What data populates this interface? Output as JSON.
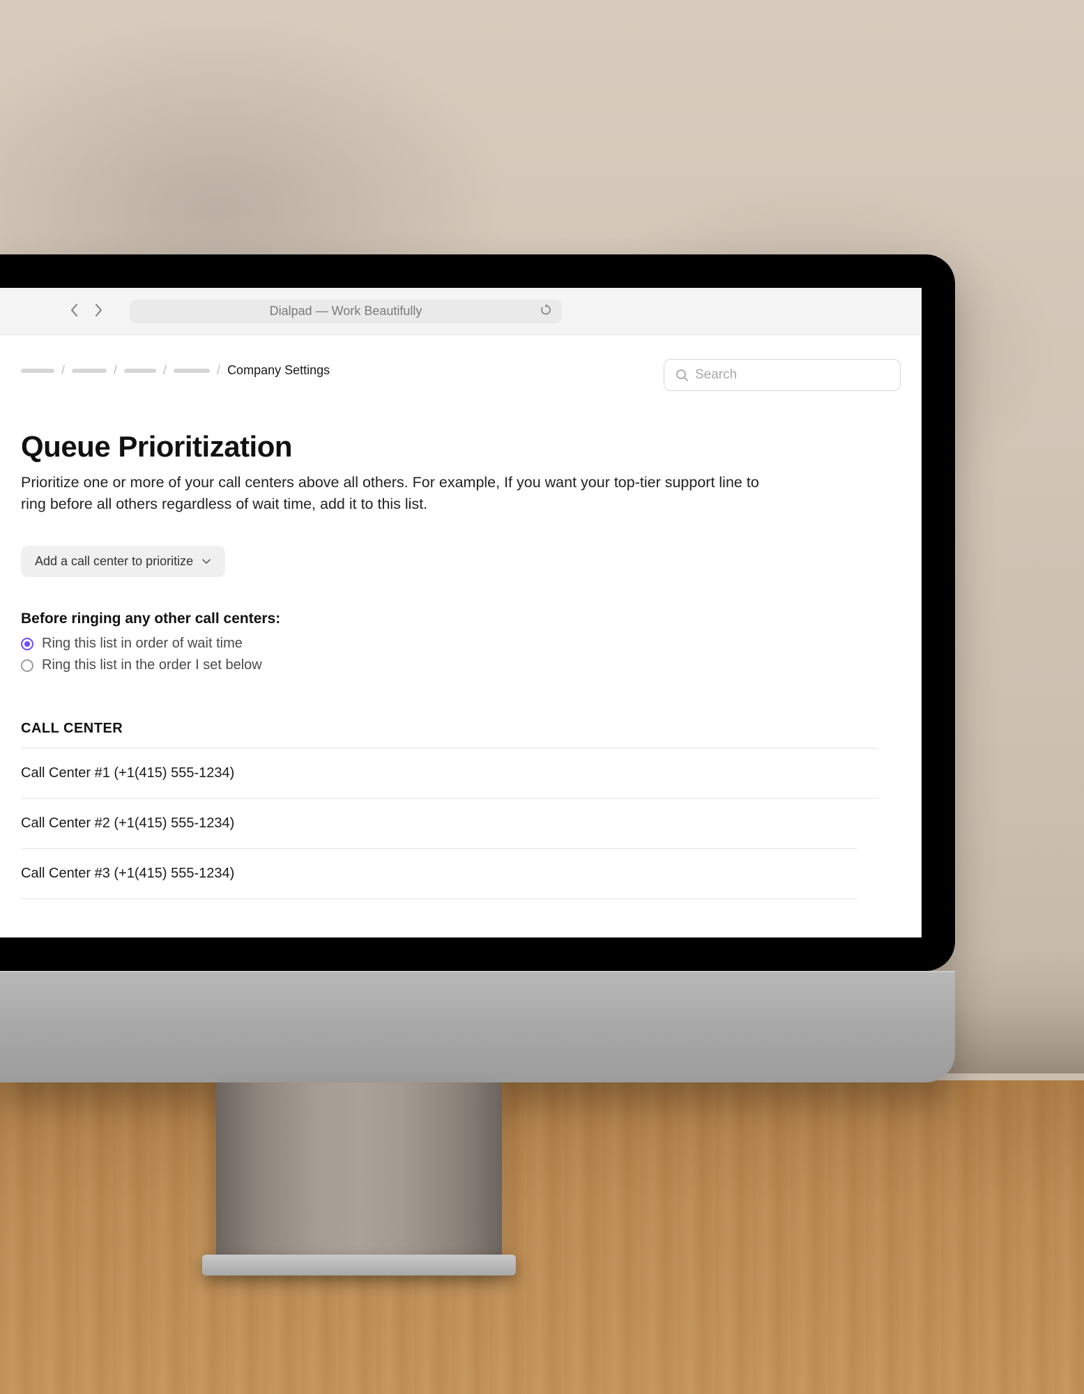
{
  "browser": {
    "title": "Dialpad — Work Beautifully"
  },
  "breadcrumb": {
    "current": "Company Settings"
  },
  "search": {
    "placeholder": "Search"
  },
  "page": {
    "title": "Queue Prioritization",
    "description": "Prioritize one or more of your call centers above all others. For example, If you want your top-tier support line to ring before all others regardless of wait time, add it to this list."
  },
  "actions": {
    "add_button": "Add a call center to prioritize"
  },
  "ring": {
    "heading": "Before ringing any other call centers:",
    "options": [
      {
        "label": "Ring this list in order of wait time",
        "selected": true
      },
      {
        "label": "Ring this list in the order I set below",
        "selected": false
      }
    ]
  },
  "table": {
    "header": "CALL CENTER",
    "rows": [
      "Call Center #1 (+1(415) 555-1234)",
      "Call Center #2 (+1(415) 555-1234)",
      "Call Center #3 (+1(415) 555-1234)"
    ]
  }
}
